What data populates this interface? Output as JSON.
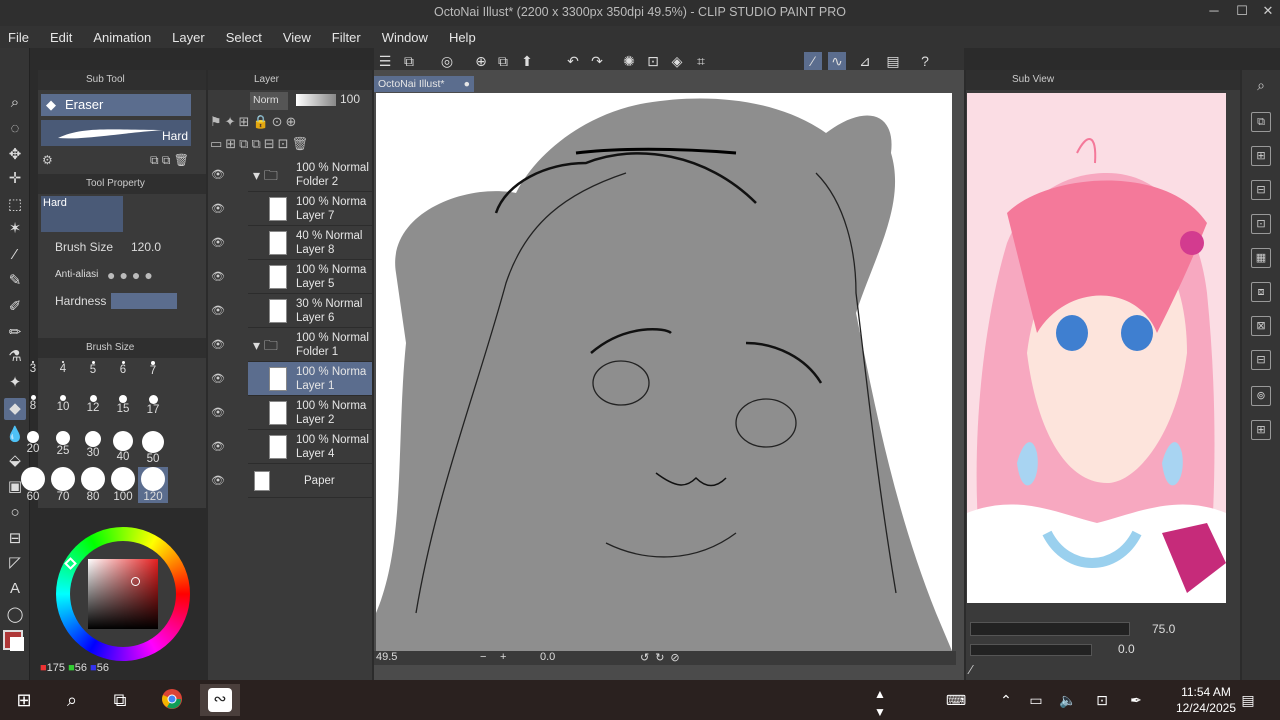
{
  "window": {
    "title": "OctoNai Illust* (2200 x 3300px 350dpi 49.5%) - CLIP STUDIO PAINT PRO",
    "min_icon": "minimize-icon",
    "max_icon": "maximize-icon",
    "close_icon": "close-icon"
  },
  "menu": [
    "File",
    "Edit",
    "Animation",
    "Layer",
    "Select",
    "View",
    "Filter",
    "Window",
    "Help"
  ],
  "sub_tool": {
    "header": "Sub Tool",
    "selected_tool": "Eraser",
    "preview_label": "Hard"
  },
  "tool_property": {
    "header": "Tool Property",
    "preset_label": "Hard",
    "brush_size_label": "Brush Size",
    "brush_size_value": "120.0",
    "antialias_label": "Anti-aliasi",
    "hardness_label": "Hardness"
  },
  "brush_size_panel": {
    "header": "Brush Size",
    "sizes": [
      "3",
      "4",
      "5",
      "6",
      "7",
      "8",
      "10",
      "12",
      "15",
      "17",
      "20",
      "25",
      "30",
      "40",
      "50",
      "60",
      "70",
      "80",
      "100",
      "120"
    ],
    "selected": "120"
  },
  "color": {
    "main_hex": "#af3838",
    "sub_hex": "#ffffff",
    "r": "175",
    "g": "56",
    "b": "56"
  },
  "layer_panel": {
    "header": "Layer",
    "blend_mode": "Norm",
    "opacity": "100",
    "layers": [
      {
        "opacity": "100 %",
        "mode": "Normal",
        "name": "Folder 2",
        "type": "folder"
      },
      {
        "opacity": "100 %",
        "mode": "Norma",
        "name": "Layer 7",
        "type": "raster"
      },
      {
        "opacity": "40 %",
        "mode": "Normal",
        "name": "Layer 8",
        "type": "raster"
      },
      {
        "opacity": "100 %",
        "mode": "Norma",
        "name": "Layer 5",
        "type": "raster"
      },
      {
        "opacity": "30 %",
        "mode": "Normal",
        "name": "Layer 6",
        "type": "raster"
      },
      {
        "opacity": "100 %",
        "mode": "Normal",
        "name": "Folder 1",
        "type": "folder"
      },
      {
        "opacity": "100 %",
        "mode": "Norma",
        "name": "Layer 1",
        "type": "raster",
        "selected": true
      },
      {
        "opacity": "100 %",
        "mode": "Norma",
        "name": "Layer 2",
        "type": "raster"
      },
      {
        "opacity": "100 %",
        "mode": "Normal",
        "name": "Layer 4",
        "type": "raster"
      },
      {
        "opacity": "",
        "mode": "",
        "name": "Paper",
        "type": "paper"
      }
    ]
  },
  "canvas": {
    "tab_label": "OctoNai Illust*",
    "zoom": "49.5",
    "rotation": "0.0"
  },
  "sub_view": {
    "header": "Sub View",
    "zoom": "75.0",
    "rotation": "0.0"
  },
  "taskbar": {
    "time": "11:54 AM",
    "date": "12/24/2025"
  }
}
